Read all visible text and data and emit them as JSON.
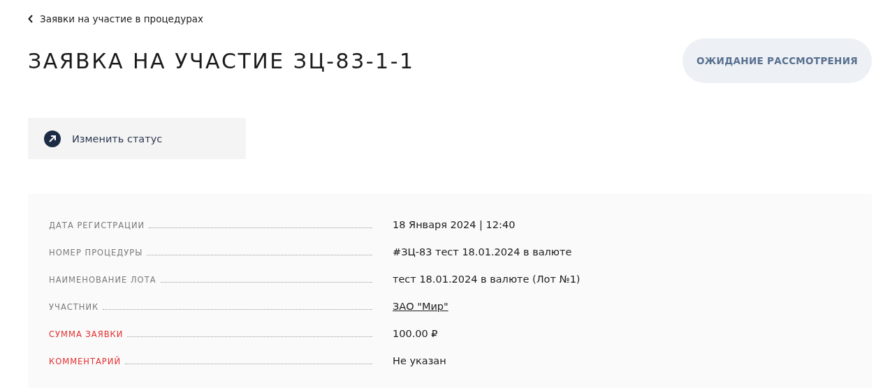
{
  "back_link": {
    "label": "Заявки на участие в процедурах"
  },
  "title": "ЗАЯВКА НА УЧАСТИЕ ЗЦ-83-1-1",
  "status": "ОЖИДАНИЕ РАССМОТРЕНИЯ",
  "action_button": {
    "label": "Изменить статус"
  },
  "details": [
    {
      "label": "ДАТА РЕГИСТРАЦИИ",
      "value": "18 Января 2024 | 12:40",
      "kind": "text",
      "highlighted": false
    },
    {
      "label": "НОМЕР ПРОЦЕДУРЫ",
      "value": "#ЗЦ-83 тест 18.01.2024 в валюте",
      "kind": "text",
      "highlighted": false
    },
    {
      "label": "НАИМЕНОВАНИЕ ЛОТА",
      "value": "тест 18.01.2024 в валюте (Лот №1)",
      "kind": "text",
      "highlighted": false
    },
    {
      "label": "УЧАСТНИК",
      "value": "ЗАО \"Мир\"",
      "kind": "link",
      "highlighted": false
    },
    {
      "label": "СУММА ЗАЯВКИ",
      "value": "100.00 ₽",
      "kind": "text",
      "highlighted": true
    },
    {
      "label": "КОММЕНТАРИЙ",
      "value": "Не указан",
      "kind": "text",
      "highlighted": true
    }
  ]
}
